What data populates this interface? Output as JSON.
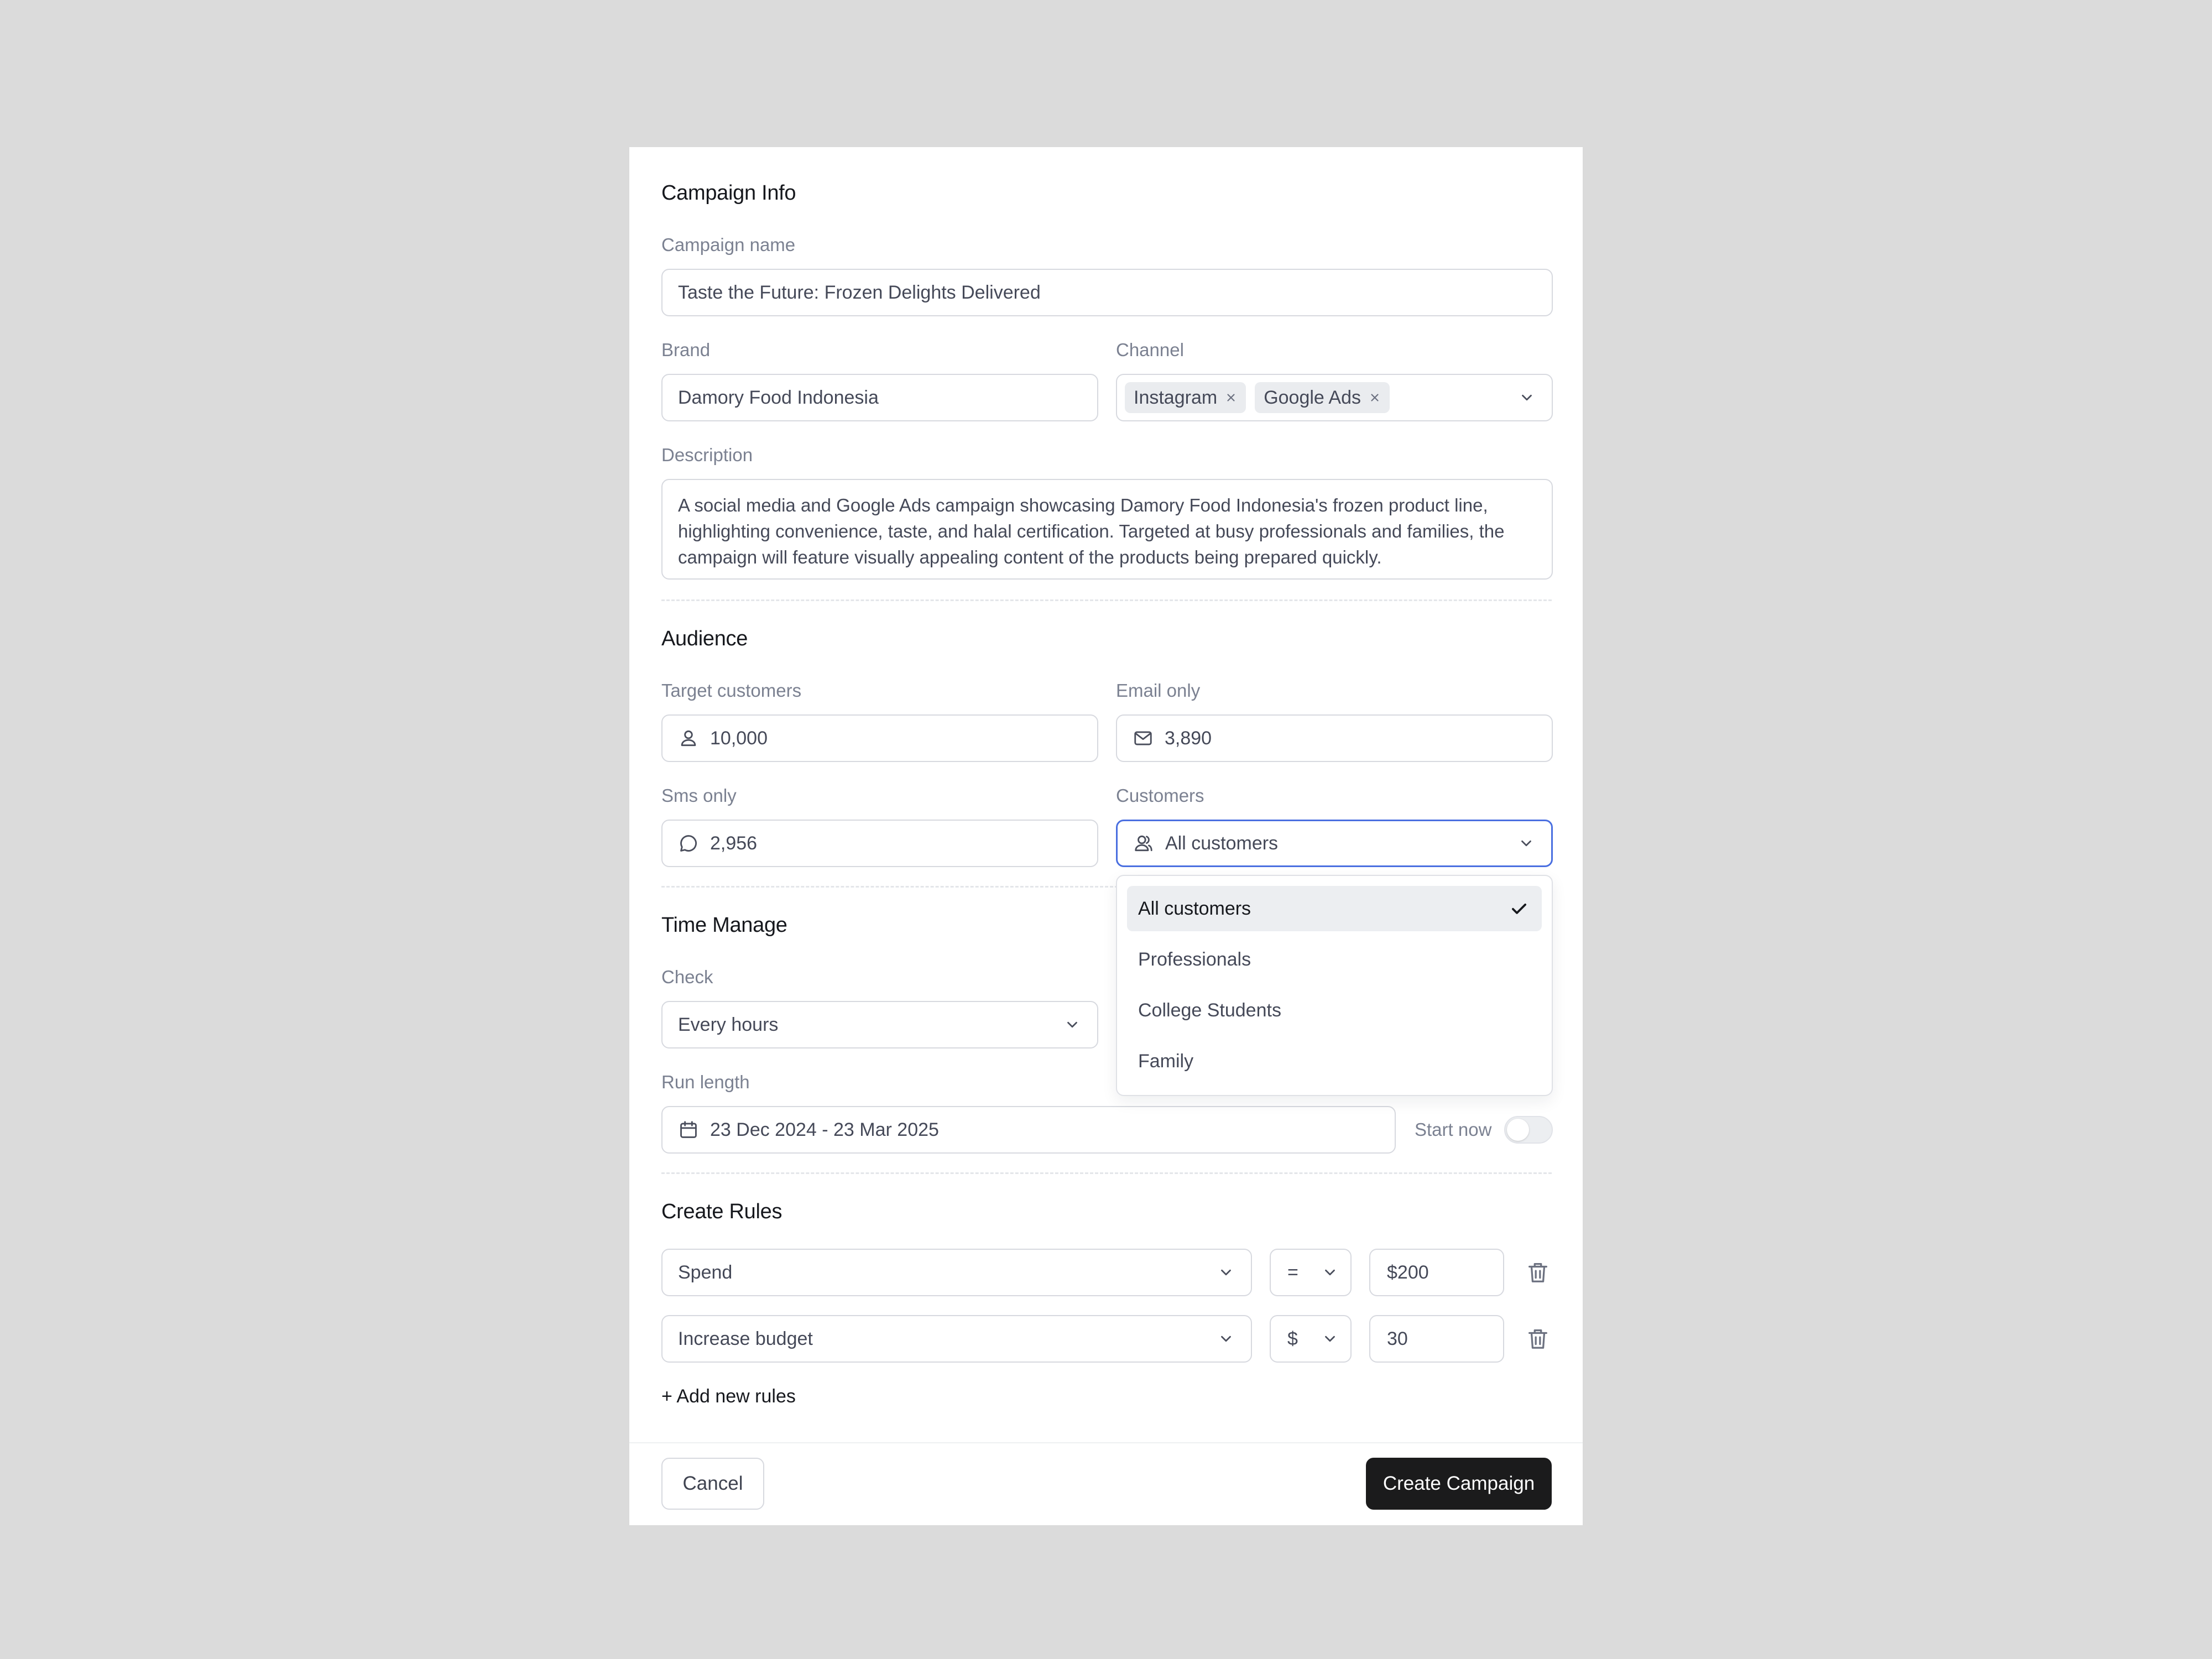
{
  "campaign_info": {
    "title": "Campaign Info",
    "campaign_name_label": "Campaign name",
    "campaign_name_value": "Taste the Future: Frozen Delights Delivered",
    "brand_label": "Brand",
    "brand_value": "Damory Food Indonesia",
    "channel_label": "Channel",
    "channels": [
      "Instagram",
      "Google Ads"
    ],
    "description_label": "Description",
    "description_value": "A social media and Google Ads campaign showcasing Damory Food Indonesia's frozen product line, highlighting convenience, taste, and halal certification. Targeted at busy professionals and families, the campaign will feature visually appealing content of the products being prepared quickly."
  },
  "audience": {
    "title": "Audience",
    "target_label": "Target customers",
    "target_value": "10,000",
    "email_label": "Email only",
    "email_value": "3,890",
    "sms_label": "Sms only",
    "sms_value": "2,956",
    "customers_label": "Customers",
    "customers_value": "All customers",
    "customer_options": [
      "All customers",
      "Professionals",
      "College Students",
      "Family"
    ],
    "selected_option": "All customers"
  },
  "time_manage": {
    "title": "Time Manage",
    "check_label": "Check",
    "check_value": "Every hours",
    "run_length_label": "Run length",
    "run_length_value": "23 Dec 2024 - 23 Mar 2025",
    "start_now_label": "Start now",
    "start_now_on": false
  },
  "rules": {
    "title": "Create Rules",
    "items": [
      {
        "field": "Spend",
        "operator": "=",
        "value": "$200"
      },
      {
        "field": "Increase budget",
        "operator": "$",
        "value": "30"
      }
    ],
    "add_label": "+ Add new rules"
  },
  "footer": {
    "cancel_label": "Cancel",
    "create_label": "Create Campaign"
  },
  "colors": {
    "page_background": "#dbdbdb",
    "focus_border": "#4a6fe0",
    "primary_button": "#1b1b1c"
  },
  "icons": [
    "x-icon",
    "chevron-down-icon",
    "user-icon",
    "mail-icon",
    "chat-bubble-icon",
    "users-icon",
    "check-icon",
    "calendar-icon",
    "trash-icon"
  ]
}
